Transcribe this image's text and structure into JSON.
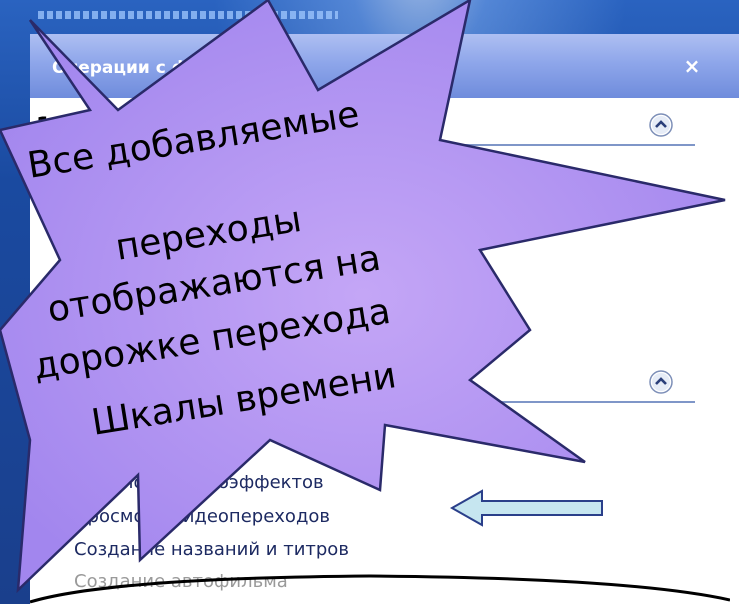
{
  "panel": {
    "title": "Операции с фильмами",
    "close_glyph": "×",
    "sections": [
      {
        "number": "1"
      },
      {
        "number": ""
      }
    ],
    "links": [
      "Просмотр видеоэффектов",
      "Просмотр видеопереходов",
      "Создание названий и титров",
      "Создание автофильма"
    ]
  },
  "callout": {
    "lines": [
      "Все добавляемые",
      "переходы",
      "отображаются на",
      "дорожке перехода",
      "Шкалы времени"
    ],
    "fill_color": "#a98cf0",
    "outline_color": "#2a2a6a"
  },
  "arrow": {
    "color": "#c6e6f0",
    "direction": "left"
  }
}
